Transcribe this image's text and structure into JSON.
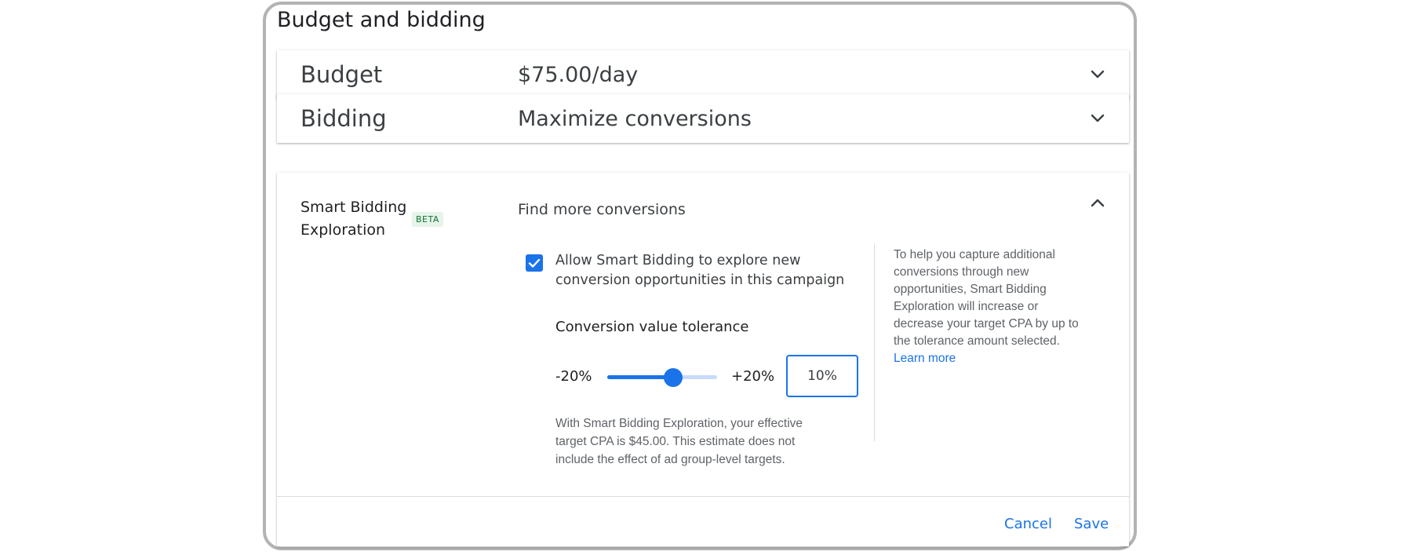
{
  "page": {
    "title": "Budget and bidding"
  },
  "budget": {
    "label": "Budget",
    "value": "$75.00/day",
    "icon": "chevron-down-icon"
  },
  "bidding": {
    "label": "Bidding",
    "value": "Maximize conversions",
    "icon": "chevron-down-icon"
  },
  "exploration": {
    "title_line1": "Smart Bidding",
    "title_line2": "Exploration",
    "badge": "BETA",
    "section_title": "Find more conversions",
    "collapse_icon": "chevron-up-icon",
    "checkbox_checked": true,
    "checkbox_label": "Allow Smart Bidding to explore new conversion opportunities in this campaign",
    "tolerance_label": "Conversion value tolerance",
    "slider": {
      "min_label": "-20%",
      "max_label": "+20%",
      "min": -20,
      "max": 20,
      "value": 10
    },
    "tolerance_value": "10%",
    "estimate_text": "With Smart Bidding Exploration, your effective target CPA is $45.00. This estimate does not include the effect of ad group-level targets.",
    "help_text": "To help you capture additional conversions through new opportunities, Smart Bidding Exploration will increase or decrease your target CPA by up to the tolerance amount selected.",
    "learn_more": "Learn more"
  },
  "actions": {
    "cancel": "Cancel",
    "save": "Save"
  },
  "colors": {
    "accent": "#1a73e8",
    "beta_bg": "#e6f4ea",
    "beta_text": "#137333"
  }
}
